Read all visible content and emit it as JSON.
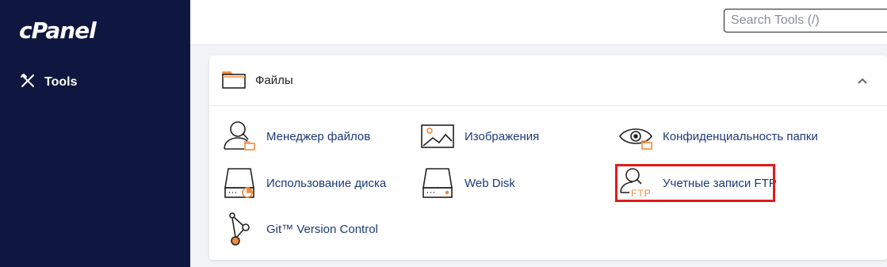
{
  "sidebar": {
    "logo": "cPanel",
    "nav": [
      {
        "label": "Tools",
        "icon": "tools-icon"
      }
    ]
  },
  "search": {
    "placeholder": "Search Tools (/)"
  },
  "files_panel": {
    "title": "Файлы",
    "items": [
      {
        "label": "Менеджер файлов",
        "icon": "file-manager-icon"
      },
      {
        "label": "Изображения",
        "icon": "images-icon"
      },
      {
        "label": "Конфиденциальность папки",
        "icon": "directory-privacy-icon"
      },
      {
        "label": "Использование диска",
        "icon": "disk-usage-icon"
      },
      {
        "label": "Web Disk",
        "icon": "web-disk-icon"
      },
      {
        "label": "Учетные записи FTP",
        "icon": "ftp-accounts-icon"
      },
      {
        "label": "Git™ Version Control",
        "icon": "git-icon"
      }
    ],
    "highlighted_item": "Учетные записи FTP",
    "ftp_icon_text": "FTP"
  },
  "colors": {
    "sidebar_bg": "#0f1740",
    "accent_orange": "#f08a3c",
    "link_blue": "#1e3a78",
    "highlight_red": "#e01b1b"
  }
}
